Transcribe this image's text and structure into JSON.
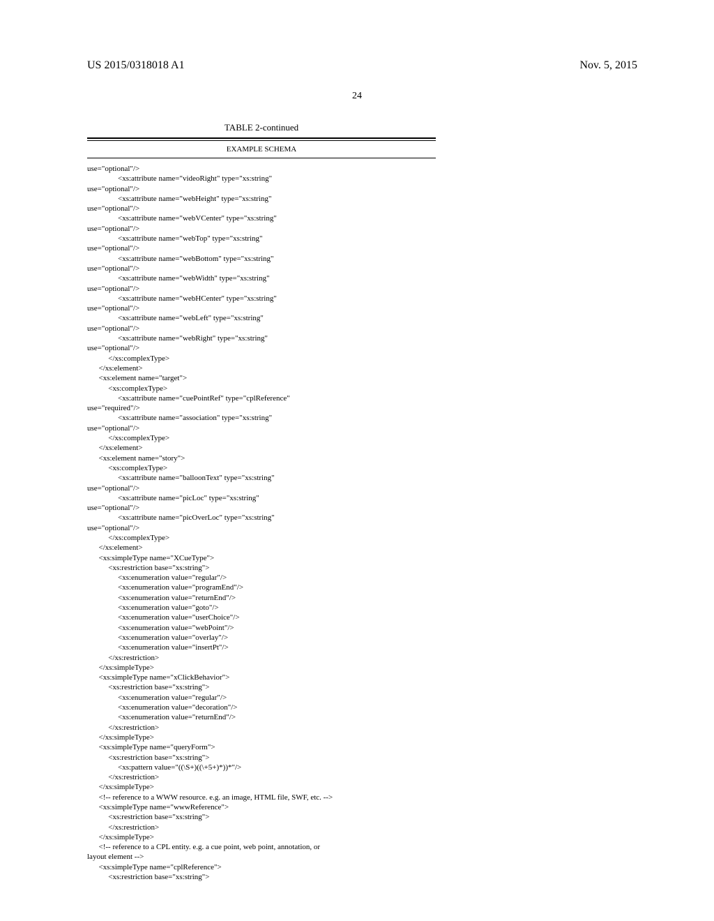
{
  "header": {
    "pub_number": "US 2015/0318018 A1",
    "pub_date": "Nov. 5, 2015",
    "page_number": "24"
  },
  "table": {
    "title": "TABLE 2-continued",
    "subtitle": "EXAMPLE SCHEMA"
  },
  "code": "use=\"optional\"/>\n                <xs:attribute name=\"videoRight\" type=\"xs:string\"\nuse=\"optional\"/>\n                <xs:attribute name=\"webHeight\" type=\"xs:string\"\nuse=\"optional\"/>\n                <xs:attribute name=\"webVCenter\" type=\"xs:string\"\nuse=\"optional\"/>\n                <xs:attribute name=\"webTop\" type=\"xs:string\"\nuse=\"optional\"/>\n                <xs:attribute name=\"webBottom\" type=\"xs:string\"\nuse=\"optional\"/>\n                <xs:attribute name=\"webWidth\" type=\"xs:string\"\nuse=\"optional\"/>\n                <xs:attribute name=\"webHCenter\" type=\"xs:string\"\nuse=\"optional\"/>\n                <xs:attribute name=\"webLeft\" type=\"xs:string\"\nuse=\"optional\"/>\n                <xs:attribute name=\"webRight\" type=\"xs:string\"\nuse=\"optional\"/>\n           </xs:complexType>\n      </xs:element>\n      <xs:element name=\"target\">\n           <xs:complexType>\n                <xs:attribute name=\"cuePointRef\" type=\"cplReference\"\nuse=\"required\"/>\n                <xs:attribute name=\"association\" type=\"xs:string\"\nuse=\"optional\"/>\n           </xs:complexType>\n      </xs:element>\n      <xs:element name=\"story\">\n           <xs:complexType>\n                <xs:attribute name=\"balloonText\" type=\"xs:string\"\nuse=\"optional\"/>\n                <xs:attribute name=\"picLoc\" type=\"xs:string\"\nuse=\"optional\"/>\n                <xs:attribute name=\"picOverLoc\" type=\"xs:string\"\nuse=\"optional\"/>\n           </xs:complexType>\n      </xs:element>\n      <xs:simpleType name=\"XCueType\">\n           <xs:restriction base=\"xs:string\">\n                <xs:enumeration value=\"regular\"/>\n                <xs:enumeration value=\"programEnd\"/>\n                <xs:enumeration value=\"returnEnd\"/>\n                <xs:enumeration value=\"goto\"/>\n                <xs:enumeration value=\"userChoice\"/>\n                <xs:enumeration value=\"webPoint\"/>\n                <xs:enumeration value=\"overlay\"/>\n                <xs:enumeration value=\"insertPt\"/>\n           </xs:restriction>\n      </xs:simpleType>\n      <xs:simpleType name=\"xClickBehavior\">\n           <xs:restriction base=\"xs:string\">\n                <xs:enumeration value=\"regular\"/>\n                <xs:enumeration value=\"decoration\"/>\n                <xs:enumeration value=\"returnEnd\"/>\n           </xs:restriction>\n      </xs:simpleType>\n      <xs:simpleType name=\"queryForm\">\n           <xs:restriction base=\"xs:string\">\n                <xs:pattern value=\"((\\S+)((\\+5+)*))*\"/>\n           </xs:restriction>\n      </xs:simpleType>\n      <!-- reference to a WWW resource. e.g. an image, HTML file, SWF, etc. -->\n      <xs:simpleType name=\"wwwReference\">\n           <xs:restriction base=\"xs:string\">\n           </xs:restriction>\n      </xs:simpleType>\n      <!-- reference to a CPL entity. e.g. a cue point, web point, annotation, or\nlayout element -->\n      <xs:simpleType name=\"cplReference\">\n           <xs:restriction base=\"xs:string\">"
}
